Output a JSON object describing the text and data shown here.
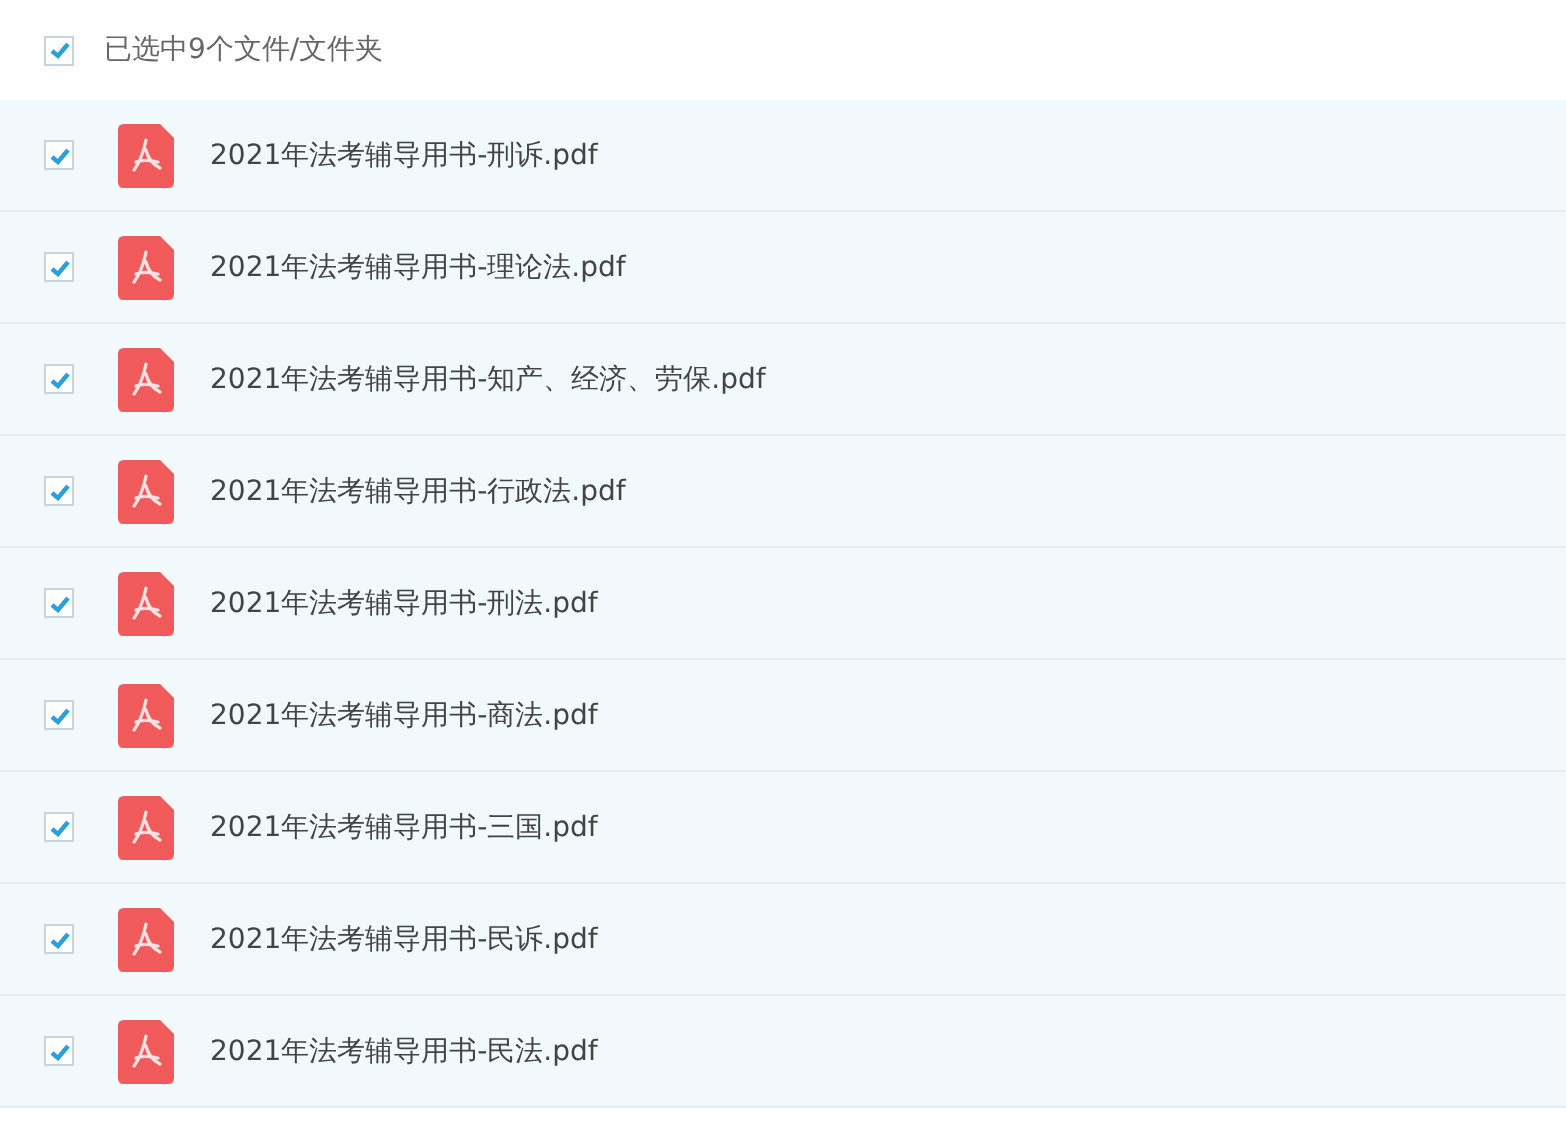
{
  "header": {
    "label": "已选中9个文件/文件夹",
    "checked": true
  },
  "files": [
    {
      "name": "2021年法考辅导用书-刑诉.pdf",
      "selected": true
    },
    {
      "name": "2021年法考辅导用书-理论法.pdf",
      "selected": true
    },
    {
      "name": "2021年法考辅导用书-知产、经济、劳保.pdf",
      "selected": true
    },
    {
      "name": "2021年法考辅导用书-行政法.pdf",
      "selected": true
    },
    {
      "name": "2021年法考辅导用书-刑法.pdf",
      "selected": true
    },
    {
      "name": "2021年法考辅导用书-商法.pdf",
      "selected": true
    },
    {
      "name": "2021年法考辅导用书-三国.pdf",
      "selected": true
    },
    {
      "name": "2021年法考辅导用书-民诉.pdf",
      "selected": true
    },
    {
      "name": "2021年法考辅导用书-民法.pdf",
      "selected": true
    }
  ]
}
